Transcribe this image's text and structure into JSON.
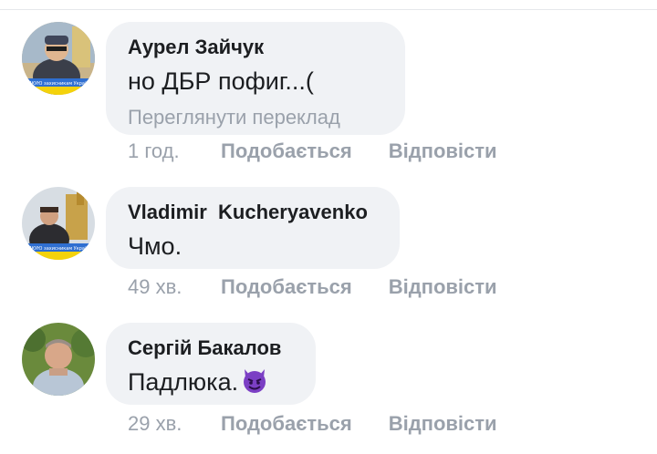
{
  "comments": [
    {
      "author": "Аурел Зайчук",
      "text": "но ДБР пофиг...(",
      "translate": "Переглянути переклад",
      "time": "1 год.",
      "like": "Подобається",
      "reply": "Відповісти",
      "avatar_banner": "ДЯКУЮ захисникам України"
    },
    {
      "author": "Vladimir  Kucheryavenko",
      "text": "Чмо.",
      "time": "49 хв.",
      "like": "Подобається",
      "reply": "Відповісти",
      "avatar_banner": "ДЯКУЮ захисникам України"
    },
    {
      "author": "Сергій Бакалов",
      "text": "Падлюка.",
      "emoji": "smiling-devil-emoji",
      "time": "29 хв.",
      "like": "Подобається",
      "reply": "Відповісти"
    }
  ],
  "colors": {
    "bubble": "#f0f2f5",
    "muted_text": "#9aa1ab",
    "main_text": "#1c1e21",
    "emoji_purple": "#7b3fc4"
  }
}
